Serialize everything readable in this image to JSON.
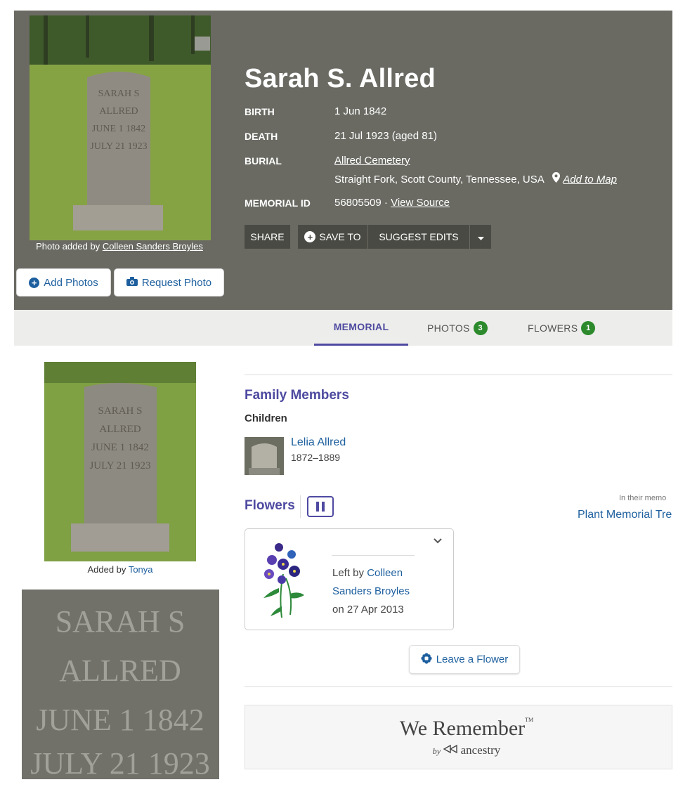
{
  "memorial": {
    "name": "Sarah S. Allred",
    "photo_credit_prefix": "Photo added by",
    "photo_credit_name": "Colleen Sanders Broyles",
    "fields": {
      "birth_label": "BIRTH",
      "birth_value": "1 Jun 1842",
      "death_label": "DEATH",
      "death_value": "21 Jul 1923 (aged 81)",
      "burial_label": "BURIAL",
      "burial_cemetery": "Allred Cemetery",
      "burial_location": "Straight Fork, Scott County, Tennessee, USA",
      "add_to_map": "Add to Map",
      "memorial_id_label": "MEMORIAL ID",
      "memorial_id_value": "56805509",
      "memorial_id_sep": "·",
      "view_source": "View Source"
    },
    "buttons": {
      "add_photos": "Add Photos",
      "request_photo": "Request Photo",
      "share": "SHARE",
      "save_to": "SAVE TO",
      "suggest_edits": "SUGGEST EDITS"
    }
  },
  "tabs": [
    {
      "label": "MEMORIAL",
      "active": true
    },
    {
      "label": "PHOTOS",
      "count": "3"
    },
    {
      "label": "FLOWERS",
      "count": "1"
    }
  ],
  "gallery": {
    "added_by_prefix": "Added by",
    "added_by_name": "Tonya"
  },
  "family": {
    "heading": "Family Members",
    "children_label": "Children",
    "children": [
      {
        "name": "Lelia Allred",
        "years": "1872–1889"
      }
    ]
  },
  "flowers": {
    "heading": "Flowers",
    "memory_label": "In their memo",
    "plant_tree": "Plant Memorial Tre",
    "card": {
      "left_by_prefix": "Left by",
      "left_by_name": "Colleen Sanders Broyles",
      "date": "on 27 Apr 2013"
    },
    "leave_flower": "Leave a Flower"
  },
  "we_remember": {
    "title": "We Remember",
    "tm": "TM",
    "by": "by",
    "brand": "ancestry"
  },
  "colors": {
    "header_bg": "#6a6a63",
    "accent_purple": "#4e4aa0",
    "link_blue": "#1d5f9e",
    "badge_green": "#2c8a2c"
  }
}
